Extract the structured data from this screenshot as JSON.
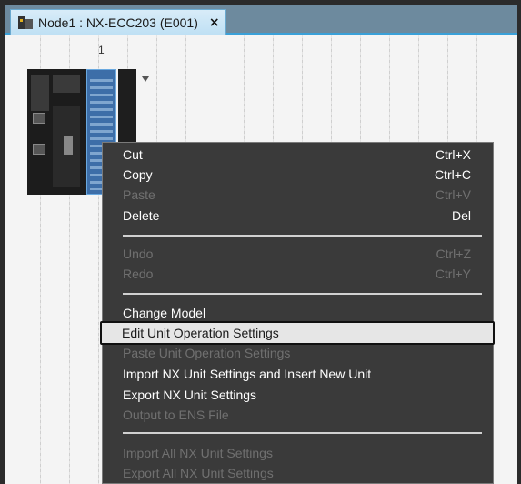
{
  "tab": {
    "title": "Node1 : NX-ECC203 (E001)",
    "close_glyph": "×",
    "icon": "device-icon"
  },
  "canvas": {
    "slot_number": "1"
  },
  "context_menu": {
    "items": [
      {
        "label": "Cut",
        "shortcut": "Ctrl+X",
        "enabled": true
      },
      {
        "label": "Copy",
        "shortcut": "Ctrl+C",
        "enabled": true
      },
      {
        "label": "Paste",
        "shortcut": "Ctrl+V",
        "enabled": false
      },
      {
        "label": "Delete",
        "shortcut": "Del",
        "enabled": true
      },
      {
        "label": "Undo",
        "shortcut": "Ctrl+Z",
        "enabled": false
      },
      {
        "label": "Redo",
        "shortcut": "Ctrl+Y",
        "enabled": false
      },
      {
        "label": "Change Model",
        "shortcut": "",
        "enabled": true
      },
      {
        "label": "Edit Unit Operation Settings",
        "shortcut": "",
        "enabled": true,
        "selected": true
      },
      {
        "label": "Paste Unit Operation Settings",
        "shortcut": "",
        "enabled": false
      },
      {
        "label": "Import NX Unit Settings and Insert New Unit",
        "shortcut": "",
        "enabled": true
      },
      {
        "label": "Export NX Unit Settings",
        "shortcut": "",
        "enabled": true
      },
      {
        "label": "Output to ENS File",
        "shortcut": "",
        "enabled": false
      },
      {
        "label": "Import All NX Unit Settings",
        "shortcut": "",
        "enabled": false
      },
      {
        "label": "Export All NX Unit Settings",
        "shortcut": "",
        "enabled": false
      }
    ]
  },
  "colors": {
    "tab_accent": "#3aa0d8",
    "menu_background": "#3a3a3a",
    "menu_text": "#ffffff",
    "menu_disabled_text": "#707070",
    "selected_item_background": "#e6e6e6",
    "unit_blue": "#3d6ea8"
  }
}
